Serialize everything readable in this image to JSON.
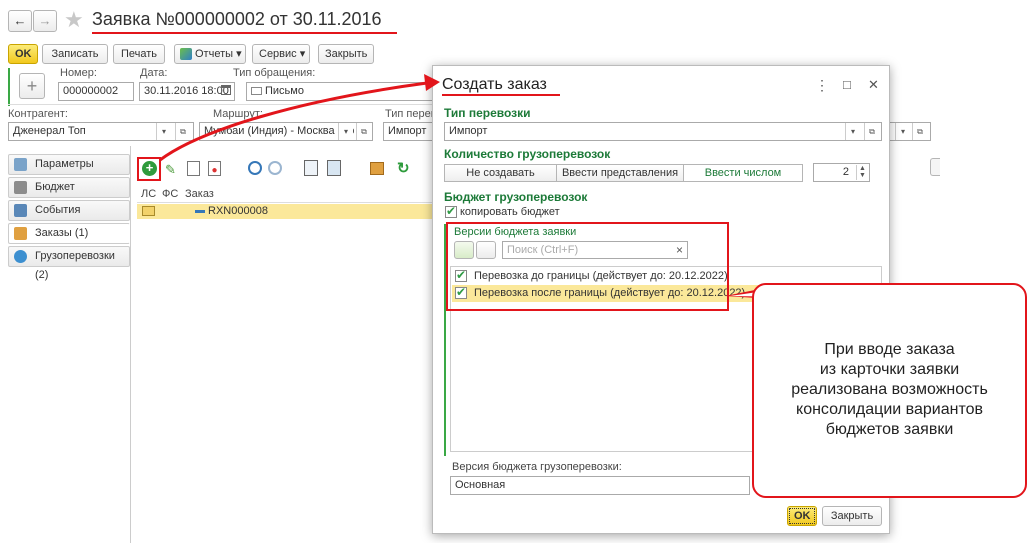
{
  "nav": {
    "back": "←",
    "forward": "→",
    "star": "★"
  },
  "title": "Заявка №000000002 от 30.11.2016",
  "toolbar": {
    "ok": "OK",
    "write": "Записать",
    "print": "Печать",
    "reports": "Отчеты ▾",
    "service": "Сервис ▾",
    "close": "Закрыть"
  },
  "form": {
    "plus": "+",
    "number_label": "Номер:",
    "number_value": "000000002",
    "date_label": "Дата:",
    "date_value": "30.11.2016 18:00",
    "appeal_label": "Тип обращения:",
    "appeal_value": "Письмо",
    "contractor_label": "Контрагент:",
    "contractor_value": "Дженерал Топ",
    "route_label": "Маршрут:",
    "route_value": "Мумбаи (Индия) - Москва (Ро",
    "shipping_label": "Тип перево",
    "shipping_value": "Импорт"
  },
  "sidebar": {
    "items": [
      {
        "label": "Параметры"
      },
      {
        "label": "Бюджет"
      },
      {
        "label": "События"
      },
      {
        "label": "Заказы (1)"
      },
      {
        "label": "Грузоперевозки (2)"
      }
    ]
  },
  "orders_table": {
    "columns": [
      "ЛС",
      "ФС",
      "Заказ"
    ],
    "rows": [
      {
        "order": "RXN000008"
      }
    ]
  },
  "dialog": {
    "title": "Создать заказ",
    "menu": "⋮",
    "maximize": "□",
    "close": "✕",
    "shipping_type_header": "Тип перевозки",
    "shipping_type_value": "Импорт",
    "count_header": "Количество грузоперевозок",
    "mode_options": [
      "Не создавать",
      "Ввести представления",
      "Ввести числом"
    ],
    "count_value": "2",
    "budget_header": "Бюджет грузоперевозок",
    "copy_budget_label": "копировать бюджет",
    "versions_header": "Версии бюджета заявки",
    "search_placeholder": "Поиск (Ctrl+F)",
    "search_clear": "×",
    "versions": [
      {
        "label": "Перевозка до границы (действует до: 20.12.2022)"
      },
      {
        "label": "Перевозка после границы (действует до: 20.12.2022)"
      }
    ],
    "budget_version_label": "Версия бюджета грузоперевозки:",
    "budget_version_value": "Основная",
    "ok": "OK",
    "close_button": "Закрыть"
  },
  "callout": {
    "lines": [
      "При вводе заказа",
      "из карточки заявки",
      "реализована возможность",
      "консолидации вариантов",
      "бюджетов заявки"
    ]
  },
  "colors": {
    "accent_green": "#1c7a38",
    "annotation_red": "#e2151b",
    "highlight_yellow": "#fbe89a"
  }
}
